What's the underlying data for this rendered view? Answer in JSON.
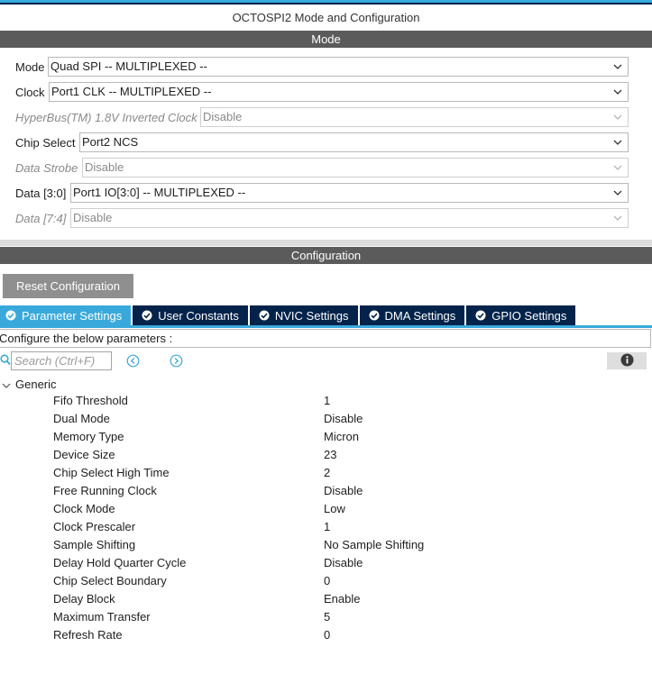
{
  "window": {
    "title": "OCTOSPI2 Mode and Configuration"
  },
  "mode_section": {
    "title": "Mode",
    "rows": [
      {
        "label": "Mode",
        "value": "Quad SPI -- MULTIPLEXED --",
        "enabled": true
      },
      {
        "label": "Clock",
        "value": "Port1 CLK -- MULTIPLEXED --",
        "enabled": true
      },
      {
        "label": "HyperBus(TM) 1.8V Inverted Clock",
        "value": "Disable",
        "enabled": false
      },
      {
        "label": "Chip Select",
        "value": "Port2 NCS",
        "enabled": true
      },
      {
        "label": "Data Strobe",
        "value": "Disable",
        "enabled": false
      },
      {
        "label": "Data [3:0]",
        "value": "Port1 IO[3:0] -- MULTIPLEXED --",
        "enabled": true
      },
      {
        "label": "Data [7:4]",
        "value": "Disable",
        "enabled": false
      }
    ]
  },
  "config_section": {
    "title": "Configuration",
    "reset_label": "Reset Configuration",
    "tabs": [
      {
        "label": "Parameter Settings",
        "active": true
      },
      {
        "label": "User Constants",
        "active": false
      },
      {
        "label": "NVIC Settings",
        "active": false
      },
      {
        "label": "DMA Settings",
        "active": false
      },
      {
        "label": "GPIO Settings",
        "active": false
      }
    ],
    "configure_text": "Configure the below parameters :",
    "search_placeholder": "Search (Ctrl+F)",
    "group": {
      "label": "Generic",
      "params": [
        {
          "name": "Fifo Threshold",
          "value": "1"
        },
        {
          "name": "Dual Mode",
          "value": "Disable"
        },
        {
          "name": "Memory Type",
          "value": "Micron"
        },
        {
          "name": "Device Size",
          "value": "23"
        },
        {
          "name": "Chip Select High Time",
          "value": "2"
        },
        {
          "name": "Free Running Clock",
          "value": "Disable"
        },
        {
          "name": "Clock Mode",
          "value": "Low"
        },
        {
          "name": "Clock Prescaler",
          "value": "1"
        },
        {
          "name": "Sample Shifting",
          "value": "No Sample Shifting"
        },
        {
          "name": "Delay Hold Quarter Cycle",
          "value": "Disable"
        },
        {
          "name": "Chip Select Boundary",
          "value": "0"
        },
        {
          "name": "Delay Block",
          "value": "Enable"
        },
        {
          "name": "Maximum Transfer",
          "value": "5"
        },
        {
          "name": "Refresh Rate",
          "value": "0"
        }
      ]
    }
  },
  "icons": {
    "search": "search-icon",
    "prev": "arrow-left-circle-icon",
    "next": "arrow-right-circle-icon",
    "info": "info-icon",
    "tab_check": "check-circle-icon",
    "dropdown": "chevron-down-icon",
    "group_toggle": "chevron-down-icon"
  },
  "colors": {
    "accent": "#39a9dc",
    "tab_dark": "#03234b",
    "section_bar": "#5b5b5b",
    "reset_button": "#8f8f8f",
    "disabled_text": "#8a8a8a"
  }
}
